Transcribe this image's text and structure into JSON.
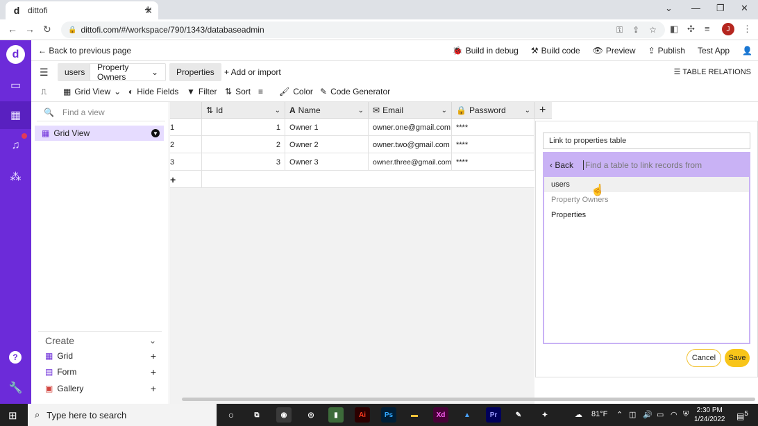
{
  "browser": {
    "tab_title": "dittofi",
    "favicon": "d",
    "url": "dittofi.com/#/workspace/790/1343/databaseadmin",
    "profile_initial": "J"
  },
  "appbar": {
    "back_label": "Back to previous page",
    "build_debug": "Build in debug",
    "build_code": "Build code",
    "preview": "Preview",
    "publish": "Publish",
    "test_app": "Test App"
  },
  "tabs": {
    "users": "users",
    "property_owners": "Property Owners",
    "properties": "Properties",
    "add_import": "+ Add or import",
    "table_relations": "TABLE RELATIONS"
  },
  "toolbar": {
    "grid_view": "Grid View",
    "hide_fields": "Hide Fields",
    "filter": "Filter",
    "sort": "Sort",
    "color": "Color",
    "code_generator": "Code Generator"
  },
  "views": {
    "search_placeholder": "Find a view",
    "active_view": "Grid View",
    "create_label": "Create",
    "create_items": [
      "Grid",
      "Form",
      "Gallery"
    ]
  },
  "grid": {
    "columns": [
      "Id",
      "Name",
      "Email",
      "Password"
    ],
    "rows": [
      {
        "row": "1",
        "id": "1",
        "name": "Owner 1",
        "email": "owner.one@gmail.com",
        "password": "****"
      },
      {
        "row": "2",
        "id": "2",
        "name": "Owner 2",
        "email": "owner.two@gmail.com",
        "password": "****"
      },
      {
        "row": "3",
        "id": "3",
        "name": "Owner 3",
        "email": "owner.three@gmail.com",
        "password": "****"
      }
    ],
    "add_row": "+",
    "add_column": "+"
  },
  "link_panel": {
    "field_name": "Link to properties table",
    "back": "Back",
    "search_placeholder": "Find a table to link records from",
    "options": [
      "users",
      "Property Owners",
      "Properties"
    ],
    "cancel": "Cancel",
    "save": "Save"
  },
  "taskbar": {
    "search_placeholder": "Type here to search",
    "temperature": "81°F",
    "time": "2:30 PM",
    "date": "1/24/2022",
    "notifications": "5"
  },
  "colors": {
    "brand_purple": "#6c2bd9",
    "picker_purple": "#c9b2f5",
    "save_yellow": "#f8c51a"
  }
}
